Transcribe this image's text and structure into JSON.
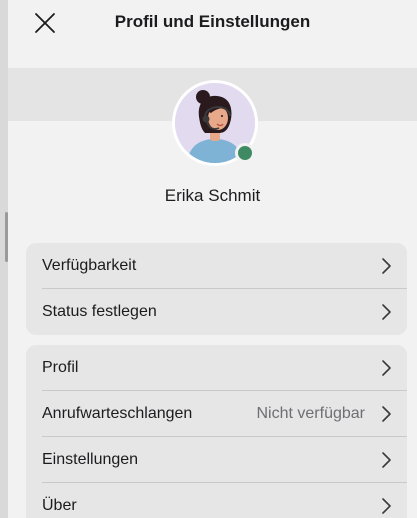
{
  "header": {
    "title": "Profil und Einstellungen"
  },
  "profile": {
    "name": "Erika Schmit",
    "presence_color": "#3f8a62"
  },
  "groups": [
    {
      "items": [
        {
          "label": "Verfügbarkeit"
        },
        {
          "label": "Status festlegen"
        }
      ]
    },
    {
      "items": [
        {
          "label": "Profil"
        },
        {
          "label": "Anrufwarteschlangen",
          "value": "Nicht verfügbar"
        },
        {
          "label": "Einstellungen"
        },
        {
          "label": "Über"
        }
      ]
    }
  ],
  "icons": {
    "close": "close-icon",
    "chevron": "chevron-right-icon",
    "avatar": "user-avatar-illustration",
    "presence": "presence-status-icon"
  }
}
